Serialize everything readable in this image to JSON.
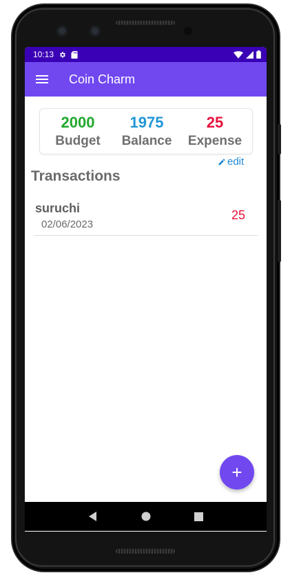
{
  "status_bar": {
    "time": "10:13"
  },
  "app_bar": {
    "title": "Coin Charm"
  },
  "summary": {
    "budget": {
      "value": "2000",
      "label": "Budget",
      "color": "#21a82d"
    },
    "balance": {
      "value": "1975",
      "label": "Balance",
      "color": "#2196d6"
    },
    "expense": {
      "value": "25",
      "label": "Expense",
      "color": "#e8113b"
    }
  },
  "edit_label": "edit",
  "transactions": {
    "title": "Transactions",
    "items": [
      {
        "name": "suruchi",
        "date": "02/06/2023",
        "amount": "25"
      }
    ]
  },
  "fab": {
    "icon": "plus-icon",
    "glyph": "+"
  },
  "colors": {
    "primary": "#7148f0",
    "status_bar": "#3a00b5"
  }
}
